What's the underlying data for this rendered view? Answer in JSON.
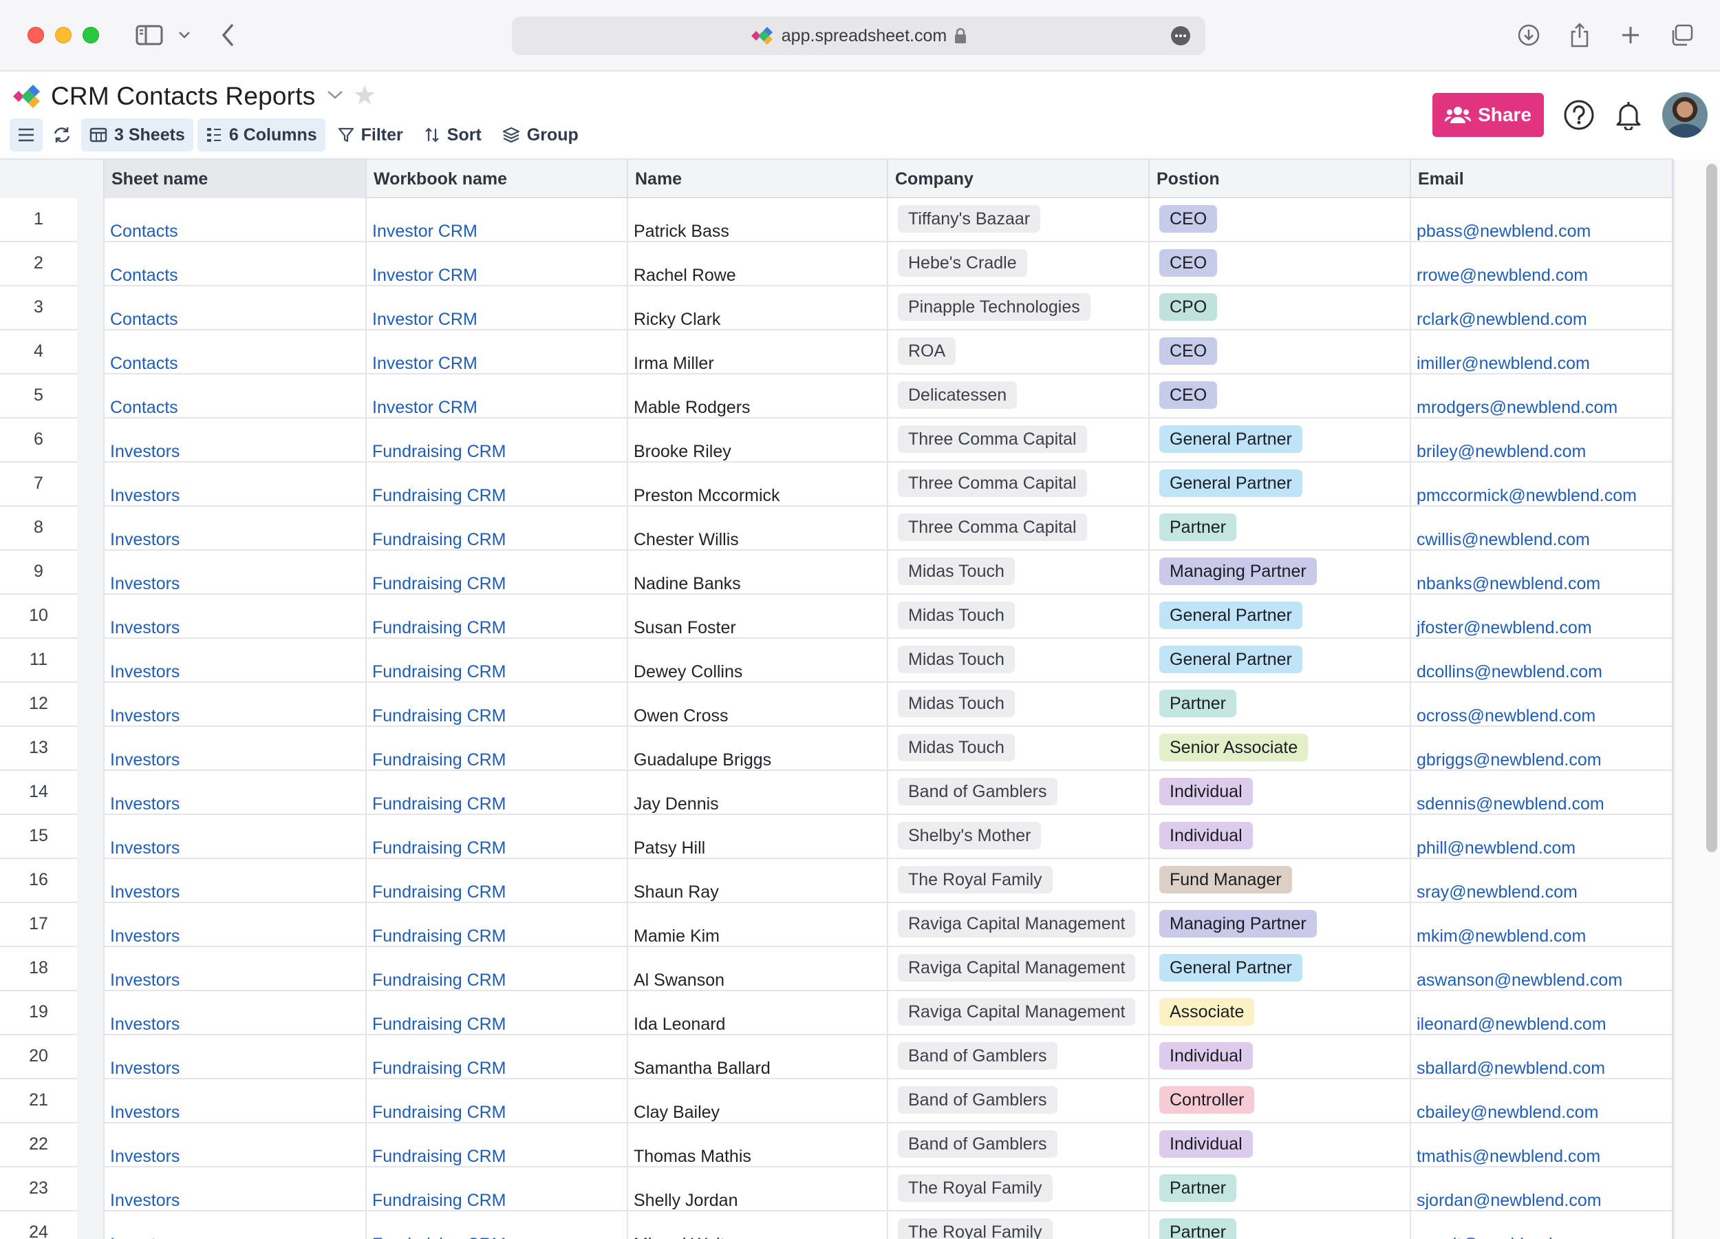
{
  "browser": {
    "url": "app.spreadsheet.com"
  },
  "app": {
    "title": "CRM Contacts Reports",
    "toolbar": {
      "sheets_label": "3 Sheets",
      "columns_label": "6 Columns",
      "filter_label": "Filter",
      "sort_label": "Sort",
      "group_label": "Group"
    },
    "share_label": "Share",
    "accent_color": "#e1337f"
  },
  "table": {
    "columns": [
      "Sheet name",
      "Workbook name",
      "Name",
      "Company",
      "Postion",
      "Email"
    ],
    "rows": [
      {
        "n": "1",
        "sheet": "Contacts",
        "workbook": "Investor CRM",
        "name": "Patrick Bass",
        "company": "Tiffany's Bazaar",
        "position": "CEO",
        "email": "pbass@newblend.com"
      },
      {
        "n": "2",
        "sheet": "Contacts",
        "workbook": "Investor CRM",
        "name": "Rachel Rowe",
        "company": "Hebe's Cradle",
        "position": "CEO",
        "email": "rrowe@newblend.com"
      },
      {
        "n": "3",
        "sheet": "Contacts",
        "workbook": "Investor CRM",
        "name": "Ricky Clark",
        "company": "Pinapple Technologies",
        "position": "CPO",
        "email": "rclark@newblend.com"
      },
      {
        "n": "4",
        "sheet": "Contacts",
        "workbook": "Investor CRM",
        "name": "Irma Miller",
        "company": "ROA",
        "position": "CEO",
        "email": "imiller@newblend.com"
      },
      {
        "n": "5",
        "sheet": "Contacts",
        "workbook": "Investor CRM",
        "name": "Mable Rodgers",
        "company": "Delicatessen",
        "position": "CEO",
        "email": "mrodgers@newblend.com"
      },
      {
        "n": "6",
        "sheet": "Investors",
        "workbook": "Fundraising CRM",
        "name": "Brooke Riley",
        "company": "Three Comma Capital",
        "position": "General Partner",
        "email": "briley@newblend.com"
      },
      {
        "n": "7",
        "sheet": "Investors",
        "workbook": "Fundraising CRM",
        "name": "Preston Mccormick",
        "company": "Three Comma Capital",
        "position": "General Partner",
        "email": "pmccormick@newblend.com"
      },
      {
        "n": "8",
        "sheet": "Investors",
        "workbook": "Fundraising CRM",
        "name": "Chester Willis",
        "company": "Three Comma Capital",
        "position": "Partner",
        "email": "cwillis@newblend.com"
      },
      {
        "n": "9",
        "sheet": "Investors",
        "workbook": "Fundraising CRM",
        "name": "Nadine Banks",
        "company": "Midas Touch",
        "position": "Managing Partner",
        "email": "nbanks@newblend.com"
      },
      {
        "n": "10",
        "sheet": "Investors",
        "workbook": "Fundraising CRM",
        "name": "Susan Foster",
        "company": "Midas Touch",
        "position": "General Partner",
        "email": "jfoster@newblend.com"
      },
      {
        "n": "11",
        "sheet": "Investors",
        "workbook": "Fundraising CRM",
        "name": "Dewey Collins",
        "company": "Midas Touch",
        "position": "General Partner",
        "email": "dcollins@newblend.com"
      },
      {
        "n": "12",
        "sheet": "Investors",
        "workbook": "Fundraising CRM",
        "name": "Owen Cross",
        "company": "Midas Touch",
        "position": "Partner",
        "email": "ocross@newblend.com"
      },
      {
        "n": "13",
        "sheet": "Investors",
        "workbook": "Fundraising CRM",
        "name": "Guadalupe Briggs",
        "company": "Midas Touch",
        "position": "Senior Associate",
        "email": "gbriggs@newblend.com"
      },
      {
        "n": "14",
        "sheet": "Investors",
        "workbook": "Fundraising CRM",
        "name": "Jay Dennis",
        "company": "Band of Gamblers",
        "position": "Individual",
        "email": "sdennis@newblend.com"
      },
      {
        "n": "15",
        "sheet": "Investors",
        "workbook": "Fundraising CRM",
        "name": "Patsy Hill",
        "company": "Shelby's Mother",
        "position": "Individual",
        "email": "phill@newblend.com"
      },
      {
        "n": "16",
        "sheet": "Investors",
        "workbook": "Fundraising CRM",
        "name": "Shaun Ray",
        "company": "The Royal Family",
        "position": "Fund Manager",
        "email": "sray@newblend.com"
      },
      {
        "n": "17",
        "sheet": "Investors",
        "workbook": "Fundraising CRM",
        "name": "Mamie Kim",
        "company": "Raviga Capital Management",
        "position": "Managing Partner",
        "email": "mkim@newblend.com"
      },
      {
        "n": "18",
        "sheet": "Investors",
        "workbook": "Fundraising CRM",
        "name": "Al Swanson",
        "company": "Raviga Capital Management",
        "position": "General Partner",
        "email": "aswanson@newblend.com"
      },
      {
        "n": "19",
        "sheet": "Investors",
        "workbook": "Fundraising CRM",
        "name": "Ida Leonard",
        "company": "Raviga Capital Management",
        "position": "Associate",
        "email": "ileonard@newblend.com"
      },
      {
        "n": "20",
        "sheet": "Investors",
        "workbook": "Fundraising CRM",
        "name": "Samantha Ballard",
        "company": "Band of Gamblers",
        "position": "Individual",
        "email": "sballard@newblend.com"
      },
      {
        "n": "21",
        "sheet": "Investors",
        "workbook": "Fundraising CRM",
        "name": "Clay Bailey",
        "company": "Band of Gamblers",
        "position": "Controller",
        "email": "cbailey@newblend.com"
      },
      {
        "n": "22",
        "sheet": "Investors",
        "workbook": "Fundraising CRM",
        "name": "Thomas Mathis",
        "company": "Band of Gamblers",
        "position": "Individual",
        "email": "tmathis@newblend.com"
      },
      {
        "n": "23",
        "sheet": "Investors",
        "workbook": "Fundraising CRM",
        "name": "Shelly Jordan",
        "company": "The Royal Family",
        "position": "Partner",
        "email": "sjordan@newblend.com"
      },
      {
        "n": "24",
        "sheet": "Investors",
        "workbook": "Fundraising CRM",
        "name": "Mirand Walt",
        "company": "The Royal Family",
        "position": "Partner",
        "email": "mwalt@newblend.com"
      }
    ]
  },
  "position_colors": {
    "CEO": "#c7cbea",
    "CPO": "#bfe3dc",
    "General Partner": "#bfe4f7",
    "Partner": "#c3e6e0",
    "Managing Partner": "#cbc9ea",
    "Senior Associate": "#e2efc8",
    "Individual": "#dccbec",
    "Fund Manager": "#ddd0c6",
    "Associate": "#fbf1c4",
    "Controller": "#f6cbd6"
  }
}
